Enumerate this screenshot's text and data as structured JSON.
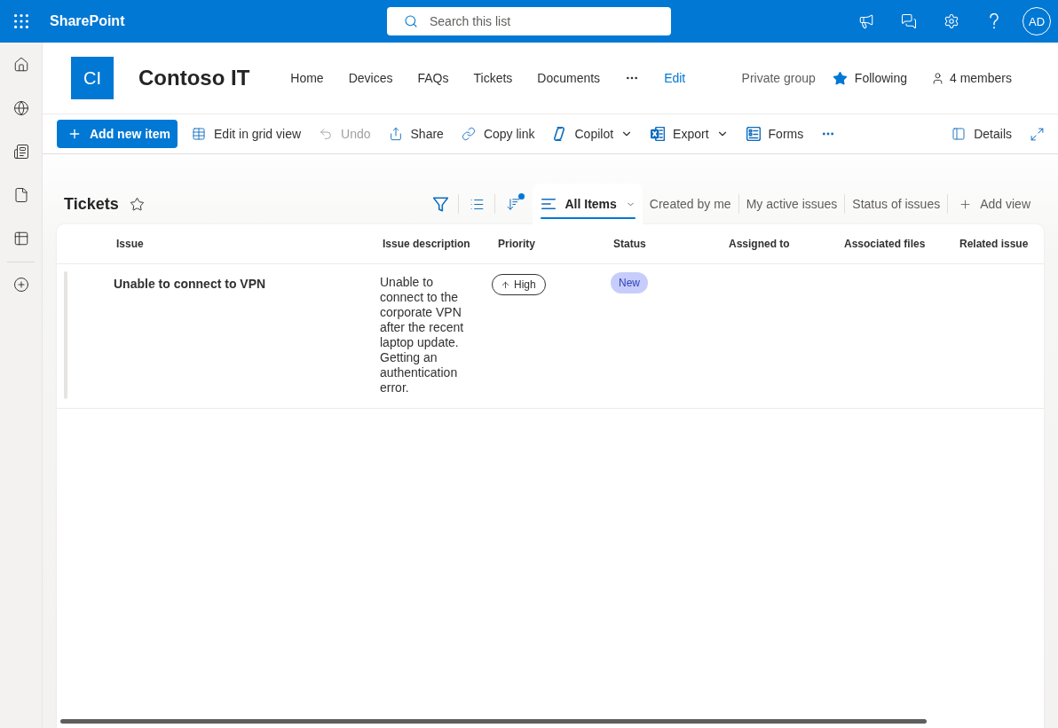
{
  "top_bar": {
    "app_name": "SharePoint",
    "search": {
      "placeholder": "Search this list"
    },
    "avatar": "AD"
  },
  "site": {
    "logo": "CI",
    "title": "Contoso IT",
    "nav": [
      {
        "label": "Home"
      },
      {
        "label": "Devices"
      },
      {
        "label": "FAQs"
      },
      {
        "label": "Tickets"
      },
      {
        "label": "Documents"
      }
    ],
    "edit": "Edit",
    "privacy": "Private group",
    "follow": {
      "label": "Following",
      "on": true
    },
    "members": "4 members"
  },
  "command_bar": {
    "items": [
      {
        "kind": "primary",
        "label": "Add new item",
        "disabled": false
      },
      {
        "kind": "button",
        "label": "Edit in grid view",
        "disabled": false
      },
      {
        "kind": "button",
        "label": "Undo",
        "disabled": true
      },
      {
        "kind": "button",
        "label": "Share",
        "disabled": false
      },
      {
        "kind": "button",
        "label": "Copy link",
        "disabled": false
      },
      {
        "kind": "menu",
        "label": "Copilot",
        "disabled": false
      },
      {
        "kind": "menu",
        "label": "Export",
        "disabled": false
      },
      {
        "kind": "button",
        "label": "Forms",
        "disabled": false
      }
    ],
    "details": "Details"
  },
  "list": {
    "title": "Tickets",
    "favorite": false,
    "sorted": true,
    "views": [
      {
        "label": "All Items",
        "selected": true
      },
      {
        "label": "Created by me",
        "selected": false
      },
      {
        "label": "My active issues",
        "selected": false
      },
      {
        "label": "Status of issues",
        "selected": false
      }
    ],
    "add_view": "Add view"
  },
  "table": {
    "columns": [
      "Issue",
      "Issue description",
      "Priority",
      "Status",
      "Assigned to",
      "Associated files",
      "Related issue"
    ],
    "rows": [
      {
        "issue": "Unable to connect to VPN",
        "description": "Unable to connect to the corporate VPN after the recent laptop update. Getting an authentication error.",
        "priority": "High",
        "status": "New"
      }
    ]
  }
}
